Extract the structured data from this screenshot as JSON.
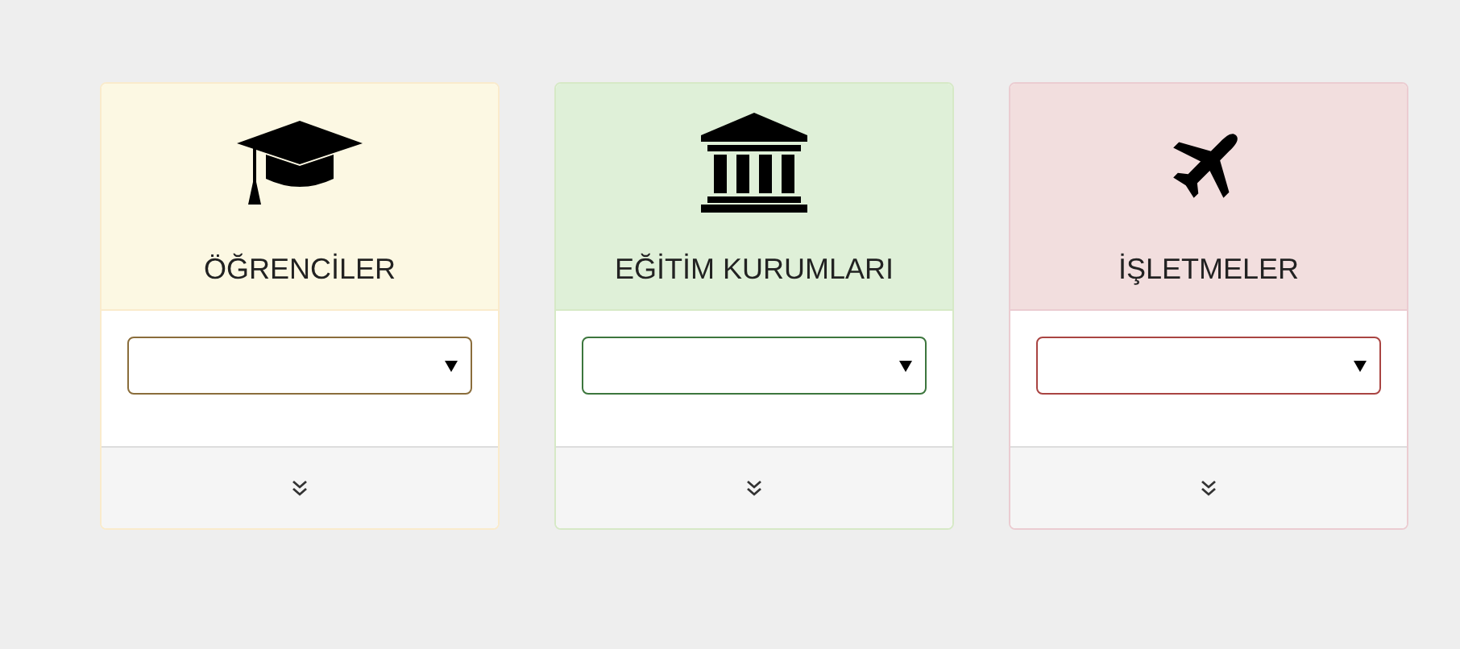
{
  "cards": [
    {
      "kind": "graduation",
      "title": "ÖĞRENCİLER",
      "color": "#fcf8e3"
    },
    {
      "kind": "institution",
      "title": "EĞİTİM KURUMLARI",
      "color": "#dff0d8"
    },
    {
      "kind": "plane",
      "title": "İŞLETMELER",
      "color": "#f2dede"
    }
  ]
}
